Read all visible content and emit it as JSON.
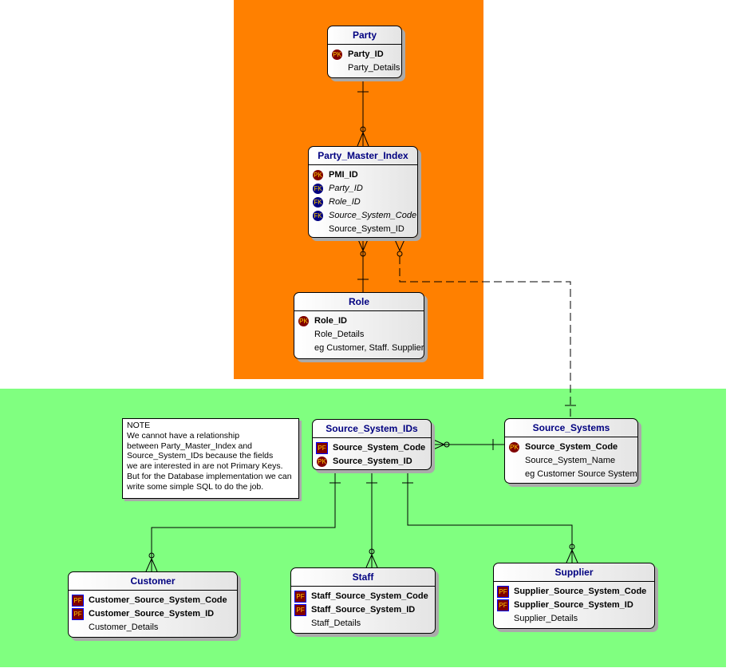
{
  "colors": {
    "subject_area_1": "#ff8000",
    "subject_area_2": "#80ff80",
    "entity_title": "#000080",
    "pk_icon": "#800000",
    "fk_icon": "#000080"
  },
  "entities": [
    {
      "id": "party",
      "name": "Party",
      "attributes": [
        {
          "key": "PK",
          "name": "Party_ID",
          "style": "b"
        },
        {
          "key": "",
          "name": "Party_Details",
          "style": ""
        }
      ]
    },
    {
      "id": "pmi",
      "name": "Party_Master_Index",
      "attributes": [
        {
          "key": "PK",
          "name": "PMI_ID",
          "style": "b"
        },
        {
          "key": "FK",
          "name": "Party_ID",
          "style": "i"
        },
        {
          "key": "FK",
          "name": "Role_ID",
          "style": "i"
        },
        {
          "key": "FK",
          "name": "Source_System_Code",
          "style": "i"
        },
        {
          "key": "",
          "name": "Source_System_ID",
          "style": ""
        }
      ]
    },
    {
      "id": "role",
      "name": "Role",
      "attributes": [
        {
          "key": "PK",
          "name": "Role_ID",
          "style": "b"
        },
        {
          "key": "",
          "name": "Role_Details",
          "style": ""
        },
        {
          "key": "",
          "name": "eg Customer, Staff. Supplier",
          "style": ""
        }
      ]
    },
    {
      "id": "ssids",
      "name": "Source_System_IDs",
      "attributes": [
        {
          "key": "PF",
          "name": "Source_System_Code",
          "style": "b"
        },
        {
          "key": "PK",
          "name": "Source_System_ID",
          "style": "b"
        }
      ]
    },
    {
      "id": "ss",
      "name": "Source_Systems",
      "attributes": [
        {
          "key": "PK",
          "name": "Source_System_Code",
          "style": "b"
        },
        {
          "key": "",
          "name": "Source_System_Name",
          "style": ""
        },
        {
          "key": "",
          "name": "eg Customer Source System",
          "style": ""
        }
      ]
    },
    {
      "id": "customer",
      "name": "Customer",
      "attributes": [
        {
          "key": "PF",
          "name": "Customer_Source_System_Code",
          "style": "b"
        },
        {
          "key": "PF",
          "name": "Customer_Source_System_ID",
          "style": "b"
        },
        {
          "key": "",
          "name": "Customer_Details",
          "style": ""
        }
      ]
    },
    {
      "id": "staff",
      "name": "Staff",
      "attributes": [
        {
          "key": "PF",
          "name": "Staff_Source_System_Code",
          "style": "b"
        },
        {
          "key": "PF",
          "name": "Staff_Source_System_ID",
          "style": "b"
        },
        {
          "key": "",
          "name": "Staff_Details",
          "style": ""
        }
      ]
    },
    {
      "id": "supplier",
      "name": "Supplier",
      "attributes": [
        {
          "key": "PF",
          "name": "Supplier_Source_System_Code",
          "style": "b"
        },
        {
          "key": "PF",
          "name": "Supplier_Source_System_ID",
          "style": "b"
        },
        {
          "key": "",
          "name": "Supplier_Details",
          "style": ""
        }
      ]
    }
  ],
  "relationships": [
    {
      "from": "Party",
      "to": "Party_Master_Index",
      "type": "identifying",
      "cardinality": "one-to-zero-or-many"
    },
    {
      "from": "Role",
      "to": "Party_Master_Index",
      "type": "identifying",
      "cardinality": "one-to-zero-or-many"
    },
    {
      "from": "Source_Systems",
      "to": "Party_Master_Index",
      "type": "non-identifying",
      "cardinality": "one-to-zero-or-many"
    },
    {
      "from": "Source_Systems",
      "to": "Source_System_IDs",
      "type": "identifying",
      "cardinality": "one-to-zero-or-many"
    },
    {
      "from": "Source_System_IDs",
      "to": "Customer",
      "type": "identifying",
      "cardinality": "one-to-zero-or-one"
    },
    {
      "from": "Source_System_IDs",
      "to": "Staff",
      "type": "identifying",
      "cardinality": "one-to-zero-or-many"
    },
    {
      "from": "Source_System_IDs",
      "to": "Supplier",
      "type": "identifying",
      "cardinality": "one-to-zero-or-one"
    }
  ],
  "note": {
    "lines": [
      "NOTE",
      "We cannot have a relationship",
      "between Party_Master_Index and",
      "Source_System_IDs because the fields",
      "we are interested in are not Primary Keys.",
      "But for the Database implementation we can",
      "write some simple SQL to do the job."
    ]
  }
}
